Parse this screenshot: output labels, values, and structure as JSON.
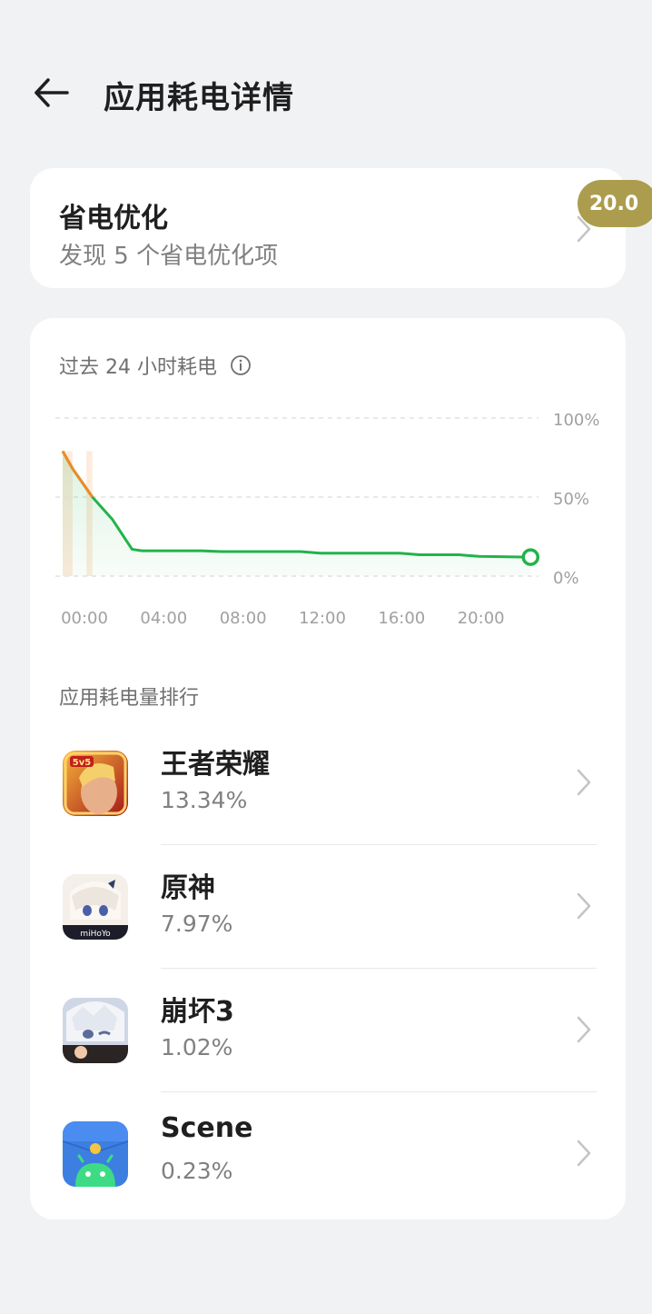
{
  "header": {
    "title": "应用耗电详情"
  },
  "optimization": {
    "title": "省电优化",
    "subtitle": "发现 5 个省电优化项",
    "badge": "20.0"
  },
  "usage": {
    "title": "过去 24 小时耗电"
  },
  "chart_data": {
    "type": "area",
    "x_ticks": [
      "00:00",
      "04:00",
      "08:00",
      "12:00",
      "16:00",
      "20:00"
    ],
    "y_ticks": [
      "100%",
      "50%",
      "0%"
    ],
    "ylim": [
      0,
      100
    ],
    "xlim": [
      0,
      24
    ],
    "grid": true,
    "series": [
      {
        "color": "#22b34a",
        "x": [
          0,
          0.5,
          1.5,
          2.5,
          3.5,
          4,
          7,
          8,
          12,
          13,
          17,
          18,
          20,
          21,
          23.6
        ],
        "values": [
          79,
          68,
          50,
          36,
          17,
          16,
          16,
          15.5,
          15.5,
          14.5,
          14.5,
          13.5,
          13.5,
          12.5,
          12
        ]
      },
      {
        "color": "#f08a24",
        "x": [
          0,
          0.5,
          1.5
        ],
        "values": [
          79,
          68,
          50
        ]
      }
    ]
  },
  "ranking": {
    "title": "应用耗电量排行",
    "apps": [
      {
        "name": "王者荣耀",
        "percent": "13.34%",
        "icon": "honor-of-kings-icon"
      },
      {
        "name": "原神",
        "percent": "7.97%",
        "icon": "genshin-impact-icon"
      },
      {
        "name": "崩坏3",
        "percent": "1.02%",
        "icon": "honkai-impact-3-icon"
      },
      {
        "name": "Scene",
        "percent": "0.23%",
        "icon": "scene-android-icon"
      }
    ]
  }
}
